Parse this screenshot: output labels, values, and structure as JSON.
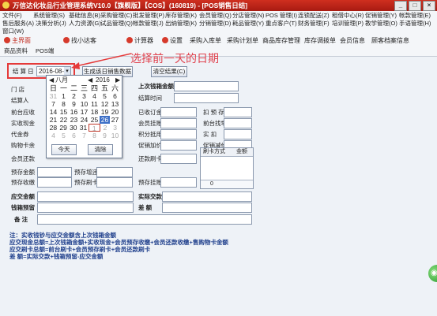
{
  "window": {
    "title": "万信达化妆品行业管理系统V10.0【旗舰版】【COS】(160819) - [POS销售日结]",
    "controls": [
      "_",
      "□",
      "×"
    ]
  },
  "menu": {
    "row1": [
      "文件(F)",
      "系统管理(S)",
      "基础信息(B)",
      "采购管理(C)",
      "批发管理(P)",
      "库存管理(K)",
      "会员管理(Q)",
      "分店管理(N)",
      "POS 管理(I)",
      "连锁配送(Z)",
      "租借中心(R)",
      "促销管理(Y)",
      "帐款管理(E)"
    ],
    "row2": [
      "售后服务(A)",
      "决策分析(J)",
      "人力资源(G)",
      "试品管理(Q)",
      "帐款管理(J)",
      "出纳管理(K)",
      "分销管理(D)",
      "耗品管理(Y)",
      "重点客户(T)",
      "财务管理(F)",
      "培训管理(P)",
      "教学管理(O)",
      "手语管理(H)"
    ],
    "row3": [
      "窗口(W)"
    ]
  },
  "toolbar": [
    "主界面",
    "找小达客",
    "计算器",
    "设置",
    "采购入库单",
    "采购计划单",
    "商品库存管理",
    "库存调拨单",
    "会员信息",
    "顾客档案信息"
  ],
  "tabs": [
    "商品资料",
    "POS端"
  ],
  "form": {
    "date_label": "结 算 日",
    "date_value": "2016-08-",
    "generate_button": "生成该日销售数据",
    "clear_button": "清空结果(C)",
    "left_labels": [
      "门 店",
      "结算人",
      "前台应收",
      "实收现金",
      "代金券",
      "购物卡余",
      "会员还款",
      "预存金额",
      "预存收缴"
    ],
    "mid_labels": [
      "预存增违",
      "预存刷卡"
    ],
    "right_top_labels": [
      "上次钱箱金额",
      "结算时间"
    ],
    "right_labels": [
      "已收订金",
      "会员挂账",
      "积分抵用",
      "促销加价",
      "还款刷卡",
      "预存挂账"
    ],
    "far_right_labels": [
      "扣 预 存",
      "前台找零",
      "实 扣",
      "促销减价"
    ],
    "grid_headers": [
      "刷卡方式",
      "金额"
    ],
    "grid_value": "0",
    "bottom_labels": [
      "应交金额",
      "钱箱预留",
      "备 注"
    ],
    "bottom_right_labels": [
      "实际交款",
      "差 额"
    ]
  },
  "calendar": {
    "month": "八月",
    "year": "2016",
    "weekdays": [
      "日",
      "一",
      "二",
      "三",
      "四",
      "五",
      "六"
    ],
    "weeks": [
      [
        "31",
        "1",
        "2",
        "3",
        "4",
        "5",
        "6"
      ],
      [
        "7",
        "8",
        "9",
        "10",
        "11",
        "12",
        "13"
      ],
      [
        "14",
        "15",
        "16",
        "17",
        "18",
        "19",
        "20"
      ],
      [
        "21",
        "22",
        "23",
        "24",
        "25",
        "26",
        "27"
      ],
      [
        "28",
        "29",
        "30",
        "31",
        "1",
        "2",
        "3"
      ],
      [
        "4",
        "5",
        "6",
        "7",
        "8",
        "9",
        "10"
      ]
    ],
    "today_button": "今天",
    "clear_button": "清除"
  },
  "annotation": "选择前一天的日期",
  "notes": {
    "title": "注：实收钱钞与应交金额含上次钱箱金额",
    "lines": [
      "应交现金总额=上次钱箱金额+实收现金+会员预存收缴+会员还款收缴+售购物卡金额",
      "应交刷卡总额=前台刷卡+会员预存刷卡+会员还款刷卡",
      "差  额=实际交款+钱箱预留-应交金额"
    ]
  },
  "colors": {
    "title_bg": "#c0281b",
    "accent": "#e53a3a",
    "selected": "#3d6fc6"
  }
}
